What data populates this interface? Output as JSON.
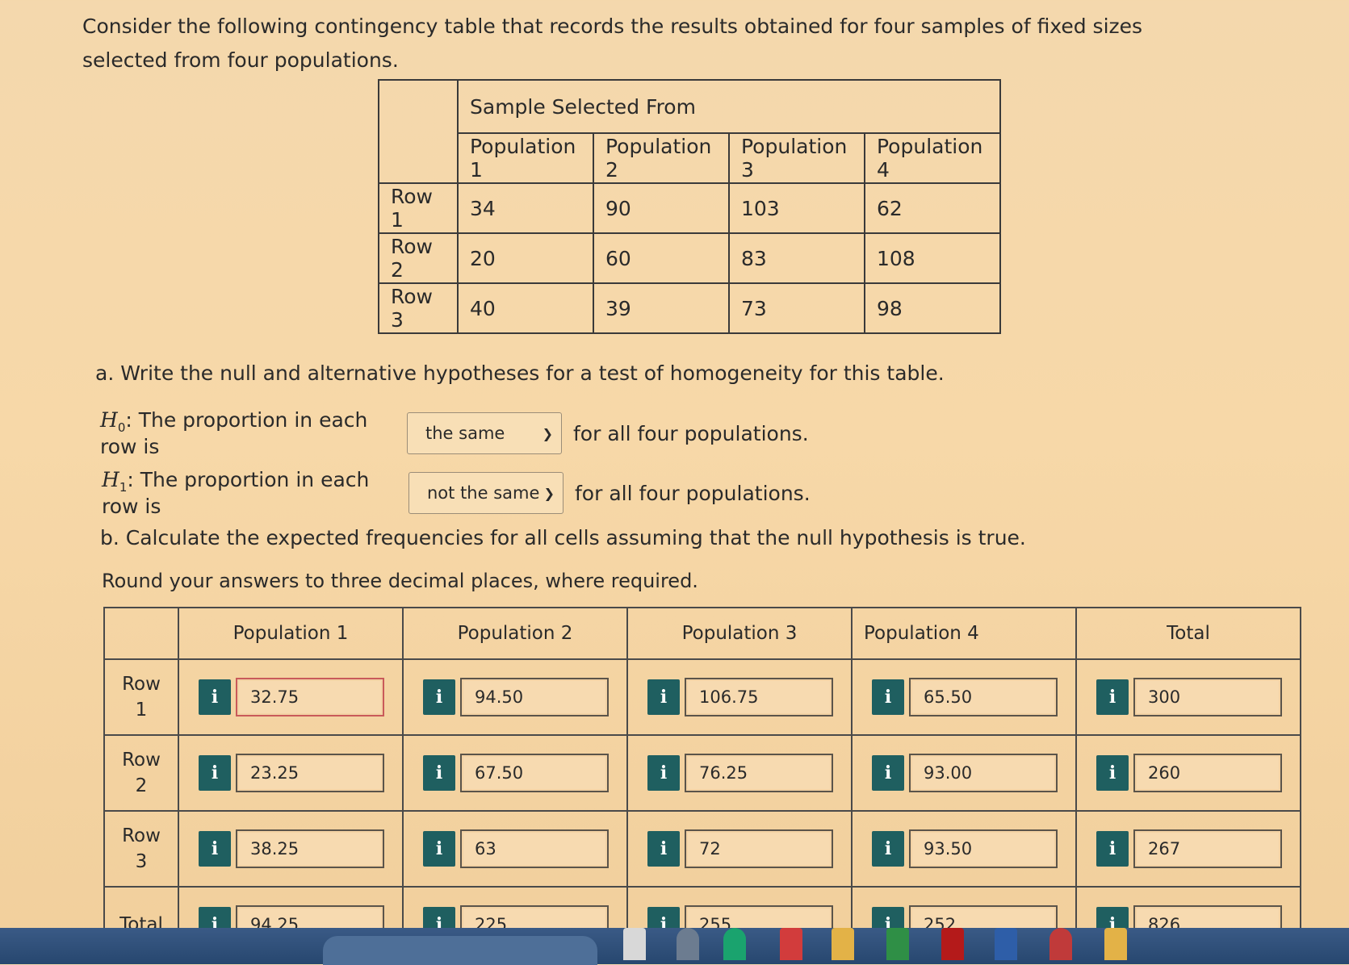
{
  "intro": "Consider the following contingency table that records the results obtained for four samples of fixed sizes selected from four populations.",
  "contingency": {
    "header": "Sample Selected From",
    "columns": [
      "Population 1",
      "Population 2",
      "Population 3",
      "Population 4"
    ],
    "rows": [
      {
        "label": "Row 1",
        "values": [
          "34",
          "90",
          "103",
          "62"
        ]
      },
      {
        "label": "Row 2",
        "values": [
          "20",
          "60",
          "83",
          "108"
        ]
      },
      {
        "label": "Row 3",
        "values": [
          "40",
          "39",
          "73",
          "98"
        ]
      }
    ]
  },
  "part_a": {
    "question": "a. Write the null and alternative hypotheses for a test of homogeneity for this table.",
    "h0_symbol": "H",
    "h0_sub": "0",
    "h0_text": ": The proportion in each row is",
    "h0_select": "the same",
    "h1_symbol": "H",
    "h1_sub": "1",
    "h1_text": ": The proportion in each row is",
    "h1_select": "not the same",
    "suffix": "for all four populations."
  },
  "part_b": {
    "question": "b. Calculate the expected frequencies for all cells assuming that the null hypothesis is true.",
    "round_note": "Round your answers to three decimal places, where required."
  },
  "expected": {
    "columns": [
      "Population 1",
      "Population 2",
      "Population 3",
      "Population 4",
      "Total"
    ],
    "rows": [
      {
        "label_line1": "Row",
        "label_line2": "1",
        "values": [
          "32.75",
          "94.50",
          "106.75",
          "65.50",
          "300"
        ]
      },
      {
        "label_line1": "Row",
        "label_line2": "2",
        "values": [
          "23.25",
          "67.50",
          "76.25",
          "93.00",
          "260"
        ]
      },
      {
        "label_line1": "Row",
        "label_line2": "3",
        "values": [
          "38.25",
          "63",
          "72",
          "93.50",
          "267"
        ]
      },
      {
        "label_line1": "Total",
        "label_line2": "",
        "values": [
          "94.25",
          "225",
          "255",
          "252",
          "826"
        ]
      }
    ],
    "info_glyph": "i"
  }
}
